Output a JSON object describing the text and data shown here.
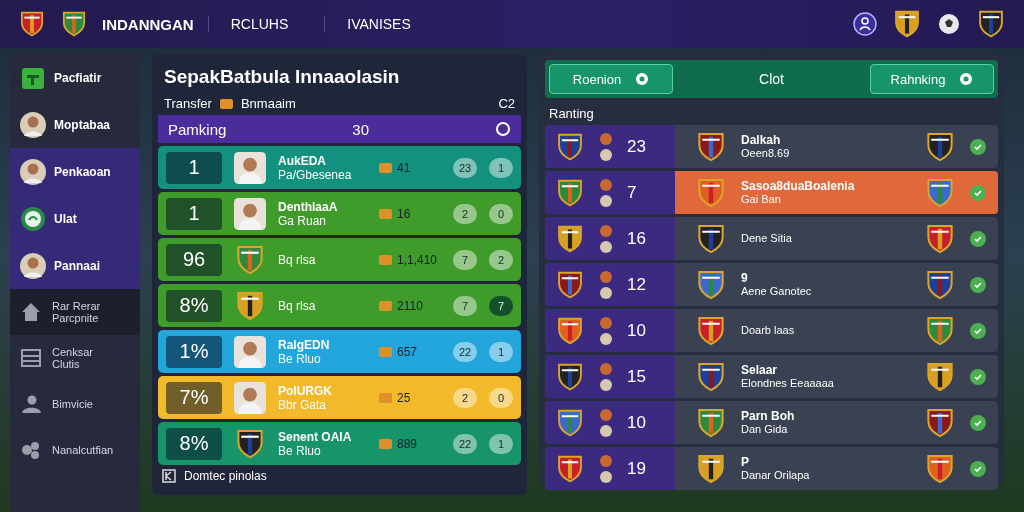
{
  "top_bar": {
    "brand": "INDANNGAN",
    "nav": [
      {
        "label": "RCLUHS"
      },
      {
        "label": "IVANISES"
      }
    ]
  },
  "sidebar": {
    "profiles": [
      {
        "label": "Pacfiatir",
        "kind": "badge",
        "selected": false
      },
      {
        "label": "Moptabaa",
        "kind": "photo",
        "selected": false
      },
      {
        "label": "Penkaoan",
        "kind": "photo",
        "selected": true
      },
      {
        "label": "Ulat",
        "kind": "emblem",
        "selected": true
      },
      {
        "label": "Pannaai",
        "kind": "photo",
        "selected": true
      }
    ],
    "items": [
      {
        "label": "Rar Rerar",
        "sub": "Parcpnite",
        "kind": "home",
        "selected": true
      },
      {
        "label": "Cenksar",
        "sub": "Clutis",
        "kind": "list",
        "selected": false
      },
      {
        "label": "Bimvicie",
        "kind": "person",
        "selected": false
      },
      {
        "label": "Nanalcutfian",
        "kind": "group",
        "selected": false
      }
    ]
  },
  "transfer_panel": {
    "title": "SepakBatbula Innaaolasin",
    "tab": "Transfer",
    "filter": "Bnmaaim",
    "counter": "C2",
    "header": {
      "label": "Pamking",
      "value": "30"
    },
    "rows": [
      {
        "rank": "1",
        "kind": "photo",
        "name": "AukEDA",
        "sub": "Pa/Gbesenea",
        "value": "41",
        "stat_1": "23",
        "stat_2": "1",
        "color": "#14907e"
      },
      {
        "rank": "1",
        "kind": "photo",
        "name": "DenthlaaA",
        "sub": "Ga Ruan",
        "value": "16",
        "stat_1": "2",
        "stat_2": "0",
        "color": "#3f9b2a"
      },
      {
        "rank": "96",
        "kind": "crest",
        "sub": "Bq rlsa",
        "value": "1,1,410",
        "stat_1": "7",
        "stat_2": "2",
        "color": "#3f9b2a"
      },
      {
        "rank": "8%",
        "kind": "crest",
        "sub": "Bq rlsa",
        "value": "2110",
        "stat_1": "7",
        "stat_2": "7",
        "color": "#3f9b2a"
      },
      {
        "rank": "1%",
        "kind": "photo",
        "name": "RalgEDN",
        "sub": "Be Rluo",
        "value": "657",
        "stat_1": "22",
        "stat_2": "1",
        "color": "#22a6dc"
      },
      {
        "rank": "7%",
        "kind": "photo",
        "name": "PolURGK",
        "sub": "Bbr Gata",
        "value": "25",
        "stat_1": "2",
        "stat_2": "0",
        "color": "#f2b92a"
      },
      {
        "rank": "8%",
        "kind": "crest",
        "name": "Senent OAIA",
        "sub": "Be Rluo",
        "value": "889",
        "stat_1": "22",
        "stat_2": "1",
        "color": "#17946a"
      }
    ],
    "footer": "Domtec pinolas"
  },
  "club_panel": {
    "buttons": [
      {
        "label": "Roenion"
      },
      {
        "label": "Rahnking"
      }
    ],
    "title": "Clot",
    "section": "Ranting",
    "rows": [
      {
        "points": "23",
        "name": "Dalkah",
        "sub": "Oeen8.69",
        "selected": false
      },
      {
        "points": "7",
        "name": "Sasoa8duaBoalenia",
        "sub": "Gai Ban",
        "selected": true
      },
      {
        "points": "16",
        "sub": "Dene Sitia",
        "selected": false
      },
      {
        "points": "12",
        "name": "9",
        "sub": "Aene Ganotec",
        "selected": false
      },
      {
        "points": "10",
        "sub": "Doarb laas",
        "selected": false
      },
      {
        "points": "15",
        "name": "Selaar",
        "sub": "Elondnes Eeaaaaa",
        "selected": false
      },
      {
        "points": "10",
        "name": "Parn Boh",
        "sub": "Dan Gida",
        "selected": false
      },
      {
        "points": "19",
        "name": "P",
        "sub": "Danar Orilapa",
        "selected": false
      }
    ]
  }
}
